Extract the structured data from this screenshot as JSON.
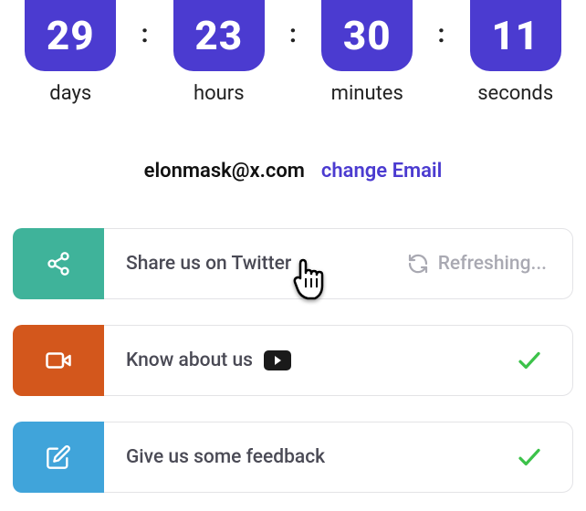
{
  "accent_color": "#4B3BD0",
  "countdown": {
    "days": {
      "value": "29",
      "label": "days"
    },
    "hours": {
      "value": "23",
      "label": "hours"
    },
    "minutes": {
      "value": "30",
      "label": "minutes"
    },
    "seconds": {
      "value": "11",
      "label": "seconds"
    },
    "separator": ":"
  },
  "email": {
    "value": "elonmask@x.com",
    "change_label": "change Email"
  },
  "tasks": [
    {
      "icon": "share-icon",
      "icon_bg": "#3FB39A",
      "title": "Share us on Twitter",
      "status": "refreshing",
      "status_label": "Refreshing..."
    },
    {
      "icon": "video-icon",
      "icon_bg": "#D3571C",
      "title": "Know about us",
      "trailing_glyph": "youtube",
      "status": "done"
    },
    {
      "icon": "edit-icon",
      "icon_bg": "#40A4DA",
      "title": "Give us some feedback",
      "status": "done"
    }
  ]
}
